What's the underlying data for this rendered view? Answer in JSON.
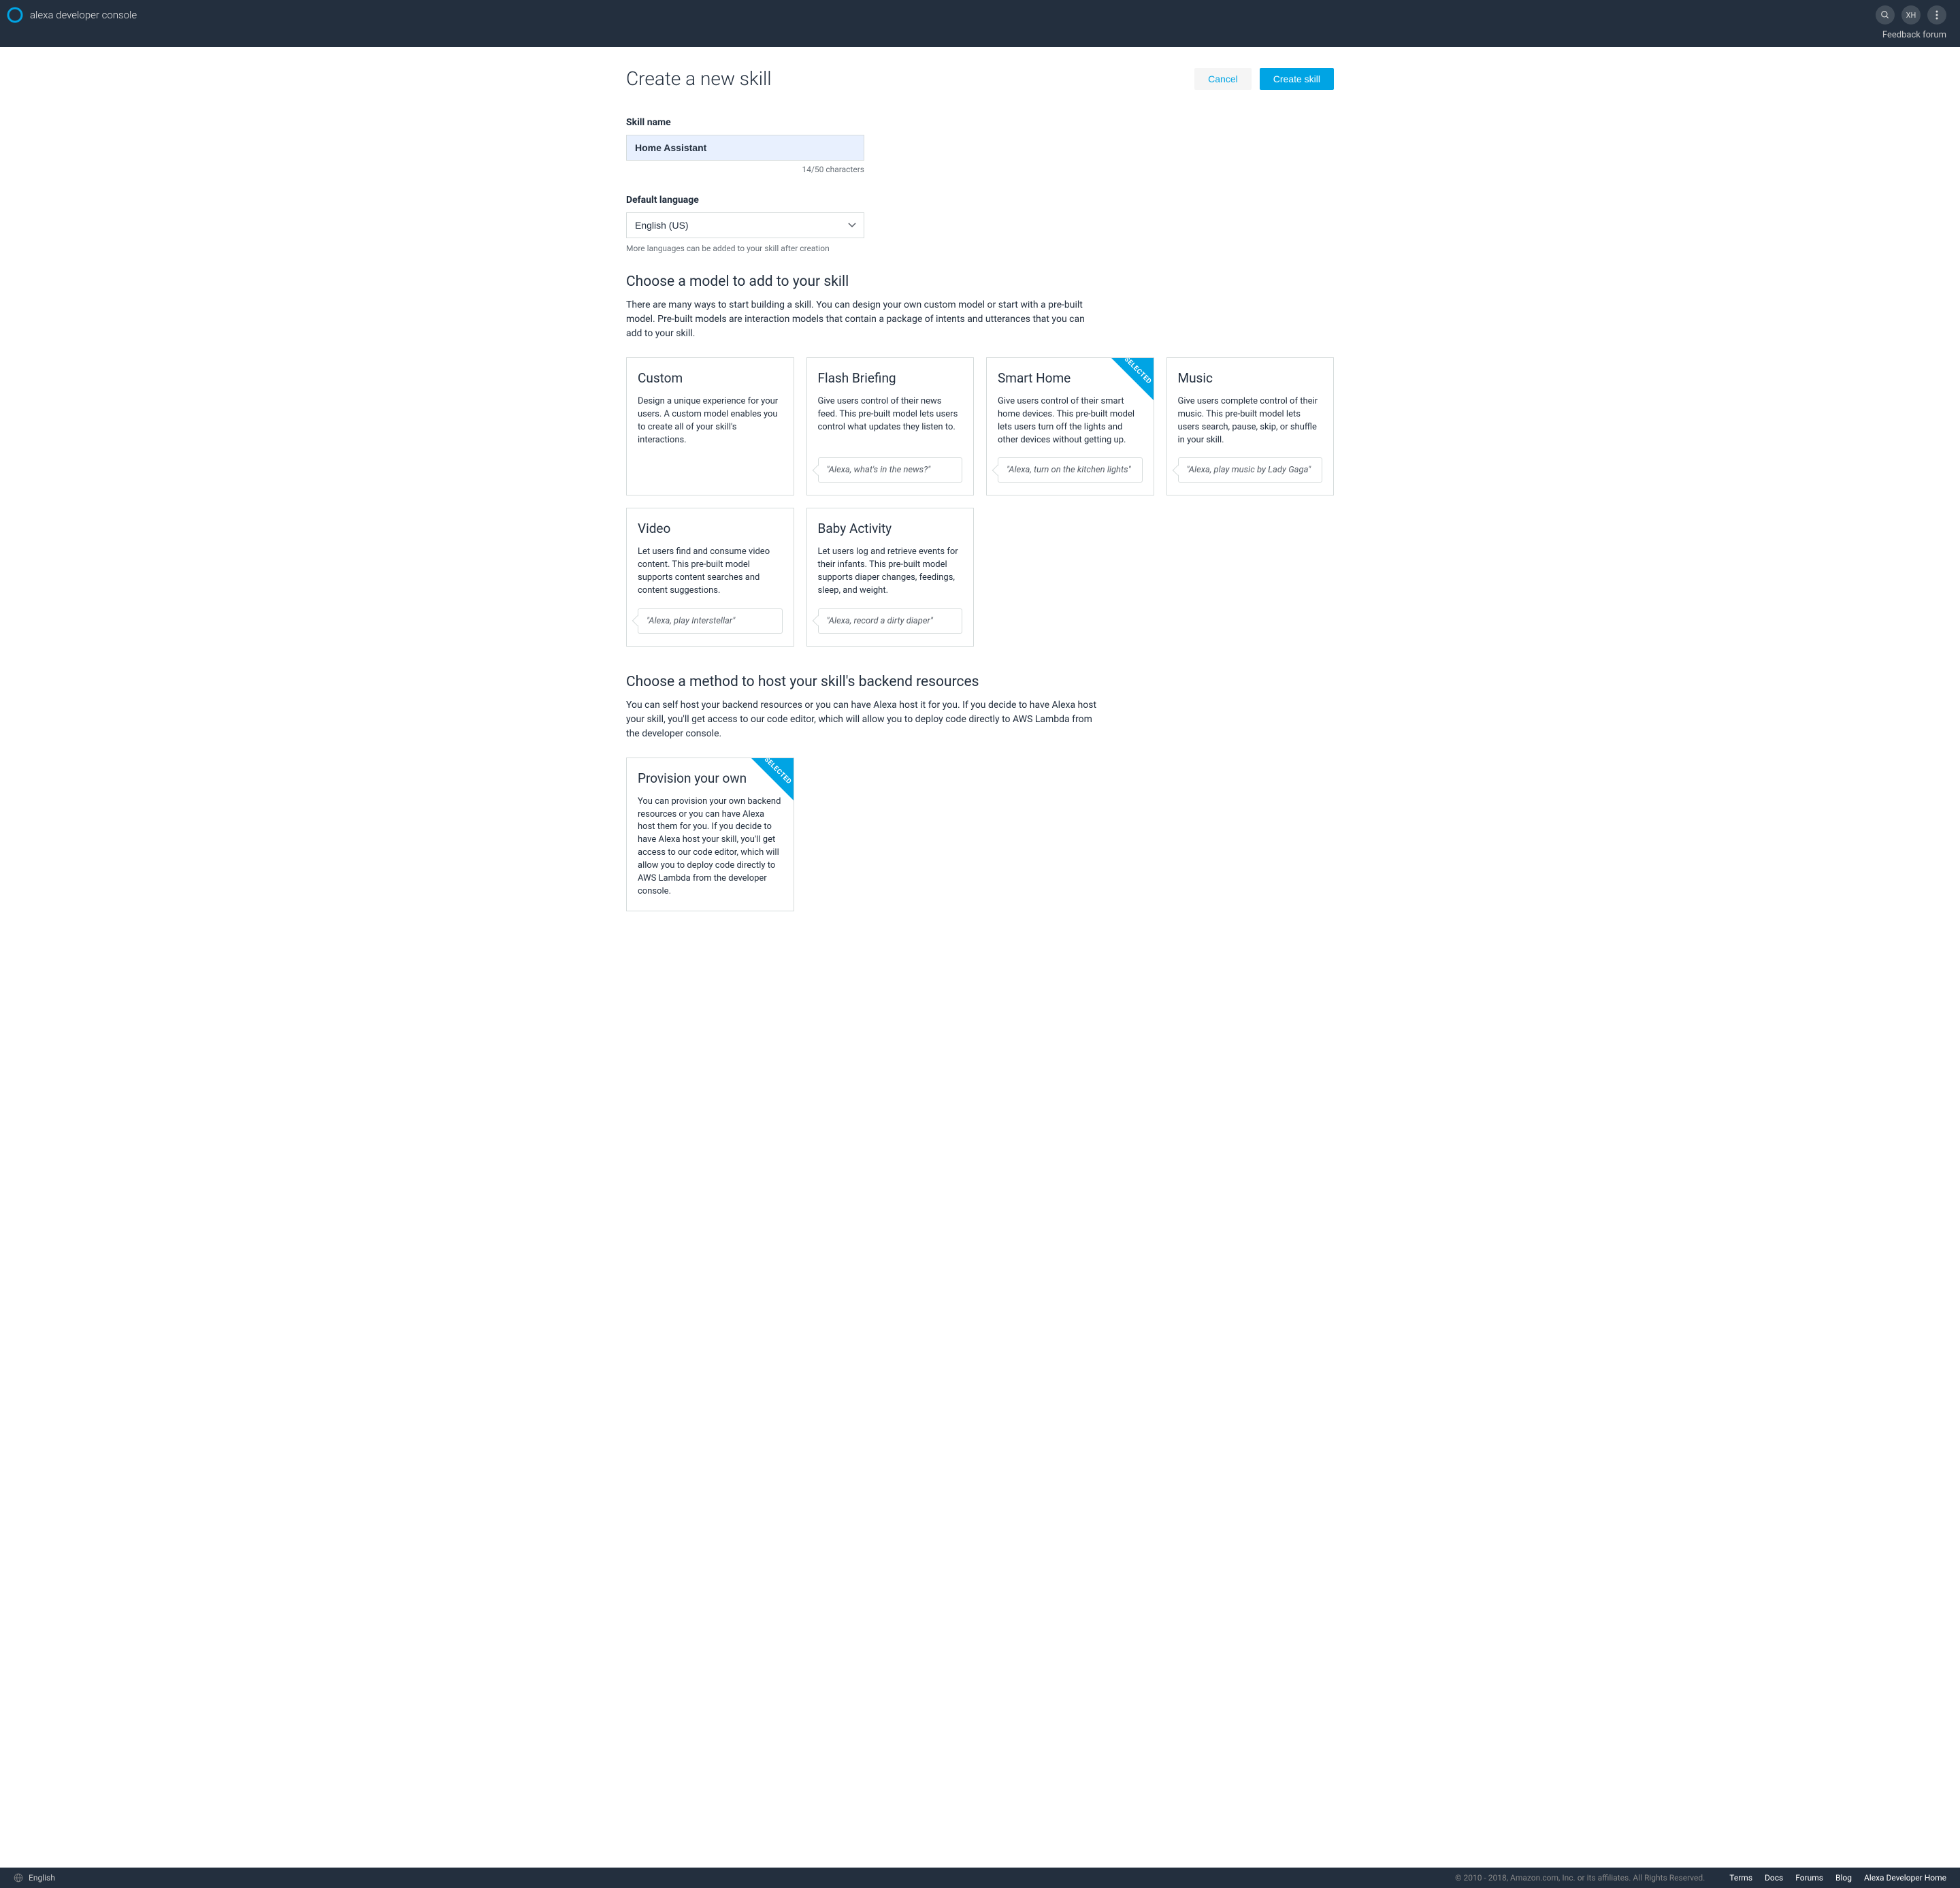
{
  "header": {
    "title": "alexa developer console",
    "user_initials": "XH",
    "feedback_link": "Feedback forum"
  },
  "page": {
    "title": "Create a new skill",
    "cancel_label": "Cancel",
    "create_label": "Create skill"
  },
  "form": {
    "skill_name_label": "Skill name",
    "skill_name_value": "Home Assistant",
    "skill_name_counter": "14/50  characters",
    "language_label": "Default language",
    "language_value": "English (US)",
    "language_hint": "More languages can be added to your skill after creation"
  },
  "model_section": {
    "title": "Choose a model to add to your skill",
    "desc": "There are many ways to start building a skill. You can design your own custom model or start with a pre-built model.  Pre-built models are interaction models that contain a package of intents and utterances that you can add to your skill."
  },
  "models": [
    {
      "id": "custom",
      "title": "Custom",
      "desc": "Design a unique experience for your users. A custom model enables you to create all of your skill's interactions.",
      "example": null,
      "selected": false
    },
    {
      "id": "flash-briefing",
      "title": "Flash Briefing",
      "desc": "Give users control of their news feed. This pre-built model lets users control what updates they listen to.",
      "example": "\"Alexa, what's in the news?\"",
      "selected": false
    },
    {
      "id": "smart-home",
      "title": "Smart Home",
      "desc": "Give users control of their smart home devices. This pre-built model lets users turn off the lights and other devices without getting up.",
      "example": "\"Alexa, turn on the kitchen lights\"",
      "selected": true
    },
    {
      "id": "music",
      "title": "Music",
      "desc": "Give users complete control of their music. This pre-built model lets users search, pause, skip, or shuffle in your skill.",
      "example": "\"Alexa, play music by Lady Gaga\"",
      "selected": false
    },
    {
      "id": "video",
      "title": "Video",
      "desc": "Let users find and consume video content. This pre-built model supports content searches and content suggestions.",
      "example": "\"Alexa, play Interstellar\"",
      "selected": false
    },
    {
      "id": "baby-activity",
      "title": "Baby Activity",
      "desc": "Let users log and retrieve events for their infants. This pre-built model supports diaper changes, feedings, sleep, and weight.",
      "example": "\"Alexa, record a dirty diaper\"",
      "selected": false
    }
  ],
  "hosting_section": {
    "title": "Choose a method to host your skill's backend resources",
    "desc": "You can self host your backend resources or you can have Alexa host it for you. If you decide to have Alexa host your skill, you'll get access to our code editor, which will allow you to deploy code directly to AWS Lambda from the developer console."
  },
  "hosting": [
    {
      "id": "provision-own",
      "title": "Provision your own",
      "desc": "You can provision your own backend resources or you can have Alexa host them for you. If you decide to have Alexa host your skill, you'll get access to our code editor, which will allow you to deploy code directly to AWS Lambda from the developer console.",
      "selected": true
    }
  ],
  "selected_ribbon_text": "SELECTED",
  "footer": {
    "language": "English",
    "copyright": "© 2010 - 2018, Amazon.com, Inc. or its affiliates. All Rights Reserved.",
    "links": [
      "Terms",
      "Docs",
      "Forums",
      "Blog",
      "Alexa Developer Home"
    ]
  }
}
